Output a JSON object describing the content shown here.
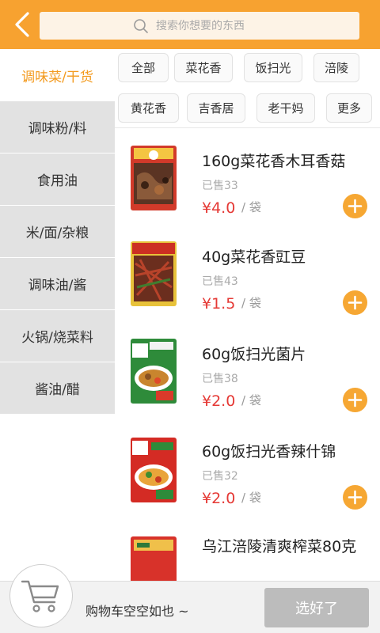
{
  "header": {
    "search_placeholder": "搜索你想要的东西"
  },
  "sidebar": {
    "items": [
      {
        "label": "调味菜/干货",
        "active": true
      },
      {
        "label": "调味粉/料",
        "active": false
      },
      {
        "label": "食用油",
        "active": false
      },
      {
        "label": "米/面/杂粮",
        "active": false
      },
      {
        "label": "调味油/酱",
        "active": false
      },
      {
        "label": "火锅/烧菜料",
        "active": false
      },
      {
        "label": "酱油/醋",
        "active": false
      }
    ]
  },
  "filters": {
    "chips": [
      {
        "label": "全部"
      },
      {
        "label": "菜花香"
      },
      {
        "label": "饭扫光"
      },
      {
        "label": "涪陵"
      },
      {
        "label": "黄花香"
      },
      {
        "label": "吉香居"
      },
      {
        "label": "老干妈"
      },
      {
        "label": "更多"
      }
    ]
  },
  "products": [
    {
      "name": "160g菜花香木耳香菇",
      "sold": "已售33",
      "price": "¥4.0",
      "unit": "/ 袋"
    },
    {
      "name": "40g菜花香豇豆",
      "sold": "已售43",
      "price": "¥1.5",
      "unit": "/ 袋"
    },
    {
      "name": "60g饭扫光菌片",
      "sold": "已售38",
      "price": "¥2.0",
      "unit": "/ 袋"
    },
    {
      "name": "60g饭扫光香辣什锦",
      "sold": "已售32",
      "price": "¥2.0",
      "unit": "/ 袋"
    },
    {
      "name": "乌江涪陵清爽榨菜80克",
      "sold": "",
      "price": "",
      "unit": ""
    }
  ],
  "cart": {
    "empty_text": "购物车空空如也 ~",
    "checkout_label": "选好了"
  },
  "colors": {
    "accent": "#f7a230",
    "price": "#e53935",
    "add_button": "#f6a733",
    "checkout_disabled": "#bcbcbc"
  }
}
